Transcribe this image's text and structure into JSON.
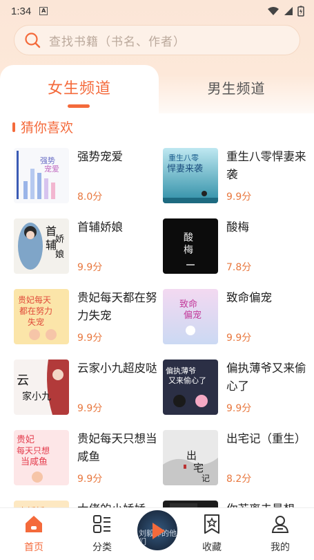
{
  "status": {
    "time": "1:34"
  },
  "search": {
    "placeholder": "查找书籍（书名、作者）"
  },
  "tabs": [
    {
      "label": "女生频道"
    },
    {
      "label": "男生频道"
    }
  ],
  "section": {
    "title": "猜你喜欢"
  },
  "books": [
    {
      "title": "强势宠爱",
      "score": "8.0分",
      "cover_text": "强势宠爱"
    },
    {
      "title": "重生八零悍妻来袭",
      "score": "9.9分",
      "cover_text": "重生八零悍妻来袭"
    },
    {
      "title": "首辅娇娘",
      "score": "9.9分",
      "cover_text": "首辅娇娘"
    },
    {
      "title": "酸梅",
      "score": "7.8分",
      "cover_text": "酸梅"
    },
    {
      "title": "贵妃每天都在努力失宠",
      "score": "9.9分",
      "cover_text": "贵妃每天都在努力失宠"
    },
    {
      "title": "致命偏宠",
      "score": "9.9分",
      "cover_text": "致命偏宠"
    },
    {
      "title": "云家小九超皮哒",
      "score": "9.9分",
      "cover_text": "云家小九"
    },
    {
      "title": "偏执薄爷又来偷心了",
      "score": "9.9分",
      "cover_text": "偏执薄爷又来偷心了"
    },
    {
      "title": "贵妃每天只想当咸鱼",
      "score": "9.9分",
      "cover_text": "贵妃每天只想当咸鱼"
    },
    {
      "title": "出宅记（重生）",
      "score": "8.2分",
      "cover_text": "出宅记"
    },
    {
      "title": "大佬的小娇娇",
      "score": "",
      "cover_text": "小娇娇"
    },
    {
      "title": "你若离去最想",
      "score": "",
      "cover_text": ""
    }
  ],
  "nav": {
    "home": "首页",
    "category": "分类",
    "favorites": "收藏",
    "mine": "我的",
    "disc_text": "刘毅萍的他们"
  },
  "colors": {
    "accent": "#f46a3b",
    "score": "#e8773e"
  }
}
